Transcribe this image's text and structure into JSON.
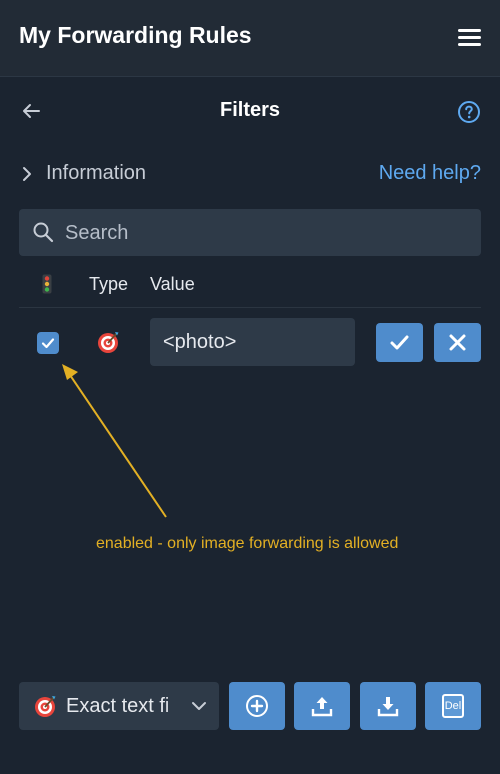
{
  "header": {
    "title": "My Forwarding Rules",
    "menu_icon": "hamburger-menu-icon"
  },
  "subheader": {
    "title": "Filters",
    "back_icon": "arrow-left-icon",
    "help_icon": "question-circle-icon"
  },
  "info": {
    "label": "Information",
    "help_link": "Need help?"
  },
  "search": {
    "placeholder": "Search",
    "value": ""
  },
  "table": {
    "columns": [
      {
        "key": "enabled",
        "icon": "traffic-light-icon"
      },
      {
        "key": "type",
        "label": "Type"
      },
      {
        "key": "value",
        "label": "Value"
      }
    ],
    "rows": [
      {
        "enabled": true,
        "type_icon": "target-icon",
        "value": "<photo>"
      }
    ]
  },
  "annotation": {
    "text": "enabled - only image forwarding is allowed",
    "color": "#e3b024"
  },
  "bottom_bar": {
    "filter_type": {
      "value": "Exact text fi",
      "icon": "target-icon"
    },
    "buttons": [
      {
        "name": "add",
        "icon": "plus-circle-icon"
      },
      {
        "name": "upload",
        "icon": "upload-icon"
      },
      {
        "name": "download",
        "icon": "download-icon"
      },
      {
        "name": "delete",
        "label": "Del"
      }
    ]
  },
  "colors": {
    "background": "#1b2430",
    "header_background": "#222b36",
    "field_background": "#2e3a48",
    "accent_button": "#4f8ccc",
    "link": "#5ea9f0"
  }
}
